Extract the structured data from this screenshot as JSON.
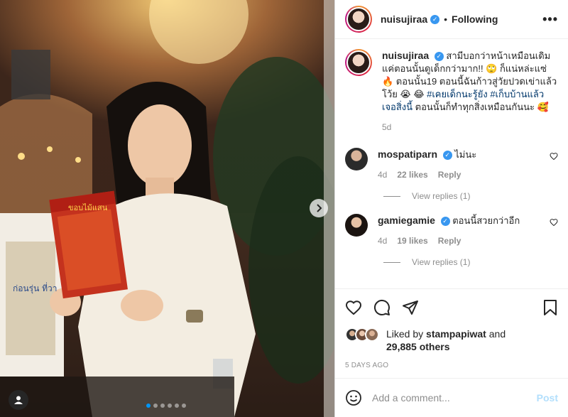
{
  "post": {
    "author": "nuisujiraa",
    "follow_status": "Following",
    "separator": "•",
    "more_label": "•••",
    "verified_mark": "✓"
  },
  "caption": {
    "username": "nuisujiraa",
    "text_before_tags": "สามีบอกว่าหน้าเหมือนเดิมแค่ตอนนั้นดูเด็กกว่ามาก!! 🙄 ก็แน่หล่ะแซ่🔥 ตอนนั้น19 ตอนนี้ฉันก้าวสู่วัยปวดเข่าแล้วโว้ย 😭 😂 ",
    "tag1": "#เคยเด็กนะรู้ยัง",
    "tag2": "#เก็บบ้านแล้วเจอสิ่งนี้",
    "text_after_tags": " ตอนนั้นก็ทำทุกสิ่งเหมือนกันนะ 🥰",
    "age": "5d"
  },
  "comments": [
    {
      "username": "mospatiparn",
      "text": "ไม่นะ",
      "age": "4d",
      "likes": "22 likes",
      "reply_label": "Reply",
      "view_replies": "View replies (1)"
    },
    {
      "username": "gamiegamie",
      "text": "ตอนนี้สวยกว่าอีก",
      "age": "4d",
      "likes": "19 likes",
      "reply_label": "Reply",
      "view_replies": "View replies (1)"
    }
  ],
  "likes": {
    "prefix": "Liked by",
    "user": "stampapiwat",
    "conjunction": "and",
    "others": "29,885 others"
  },
  "timestamp": "5 DAYS AGO",
  "add_comment": {
    "placeholder": "Add a comment...",
    "post_label": "Post"
  },
  "photo": {
    "book_title": "ขอบไม้แสน",
    "sign_text": "ก่อนรุ่น ที่วา"
  },
  "carousel": {
    "total": 6,
    "active_index": 0
  },
  "colors": {
    "accent": "#0095f6",
    "verified": "#3897f0",
    "hashtag": "#00376b",
    "post_disabled": "#b2dffc",
    "muted": "#8e8e8e"
  },
  "icons": {
    "like": "heart-icon",
    "comment": "comment-icon",
    "share": "share-icon",
    "save": "bookmark-icon",
    "emoji": "emoji-icon",
    "next": "chevron-right-icon",
    "tags": "user-tag-icon"
  }
}
